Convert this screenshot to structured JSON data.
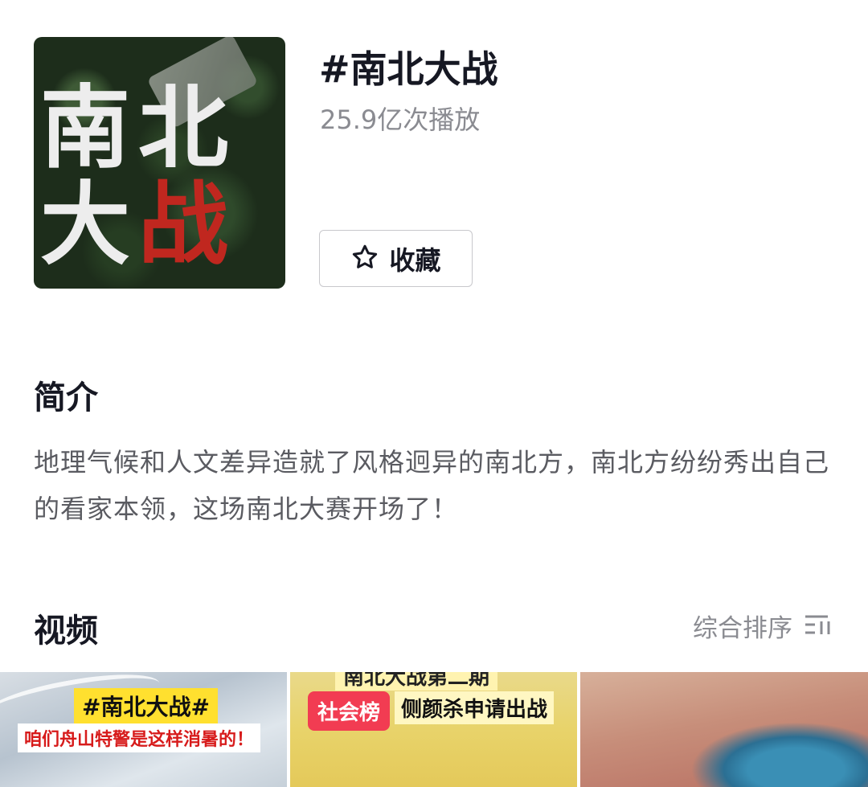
{
  "header": {
    "cover_title_chars": [
      "南",
      "北",
      "大",
      "战"
    ],
    "title": "#南北大战",
    "plays": "25.9亿次播放",
    "favorite_label": "收藏"
  },
  "intro": {
    "heading": "简介",
    "text": "地理气候和人文差异造就了风格迥异的南北方，南北方纷纷秀出自己的看家本领，这场南北大赛开场了！"
  },
  "videos": {
    "heading": "视频",
    "sort_label": "综合排序",
    "items": [
      {
        "tag": "#南北大战#",
        "subtitle": "咱们舟山特警是这样消暑的！"
      },
      {
        "badge": "社会榜",
        "top_text": "南北大战第二期",
        "line": "侧颜杀申请出战"
      },
      {}
    ]
  },
  "colors": {
    "accent_red": "#c0271f",
    "badge_pink": "#f23c52",
    "tag_yellow": "#ffe02f",
    "muted_text": "#8a8b91"
  }
}
